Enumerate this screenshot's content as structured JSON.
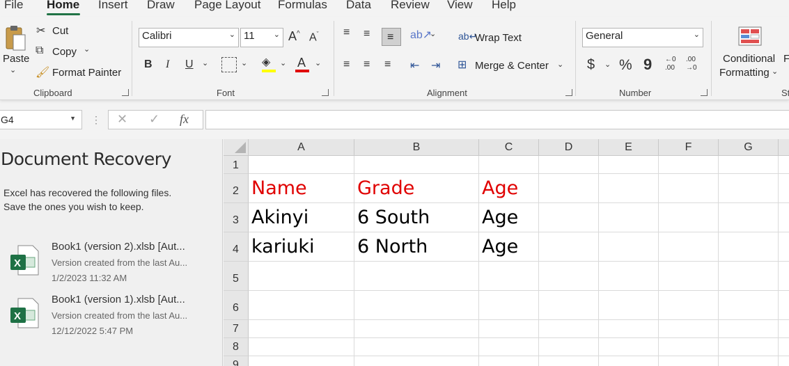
{
  "tabs": [
    "File",
    "Home",
    "Insert",
    "Draw",
    "Page Layout",
    "Formulas",
    "Data",
    "Review",
    "View",
    "Help"
  ],
  "ribbon": {
    "clipboard": {
      "paste": "Paste",
      "cut": "Cut",
      "copy": "Copy",
      "format_painter": "Format Painter",
      "label": "Clipboard"
    },
    "font": {
      "name": "Calibri",
      "size": "11",
      "label": "Font",
      "bold": "B",
      "italic": "I",
      "underline": "U",
      "grow": "A",
      "shrink": "A",
      "highlight_color": "#ffff00",
      "font_color": "#e00000"
    },
    "alignment": {
      "wrap_text": "Wrap Text",
      "merge_center": "Merge & Center",
      "label": "Alignment"
    },
    "number": {
      "format": "General",
      "currency": "$",
      "percent": "%",
      "comma": "9",
      "label": "Number",
      "inc_top": "←0",
      "inc_bottom": ".00",
      "dec_top": ".00",
      "dec_bottom": "→0"
    },
    "styles": {
      "conditional_line1": "Conditional",
      "conditional_line2": "Formatting",
      "cut_off_top": "F",
      "cut_off_bottom": "St"
    }
  },
  "formula_bar": {
    "name_box": "G4",
    "fx": "fx",
    "formula": ""
  },
  "recovery": {
    "title": "Document Recovery",
    "desc_line1": "Excel has recovered the following files.",
    "desc_line2": "Save the ones you wish to keep.",
    "files": [
      {
        "name": "Book1 (version 2).xlsb  [Aut...",
        "sub": "Version created from the last Au...",
        "date": "1/2/2023 11:32 AM"
      },
      {
        "name": "Book1 (version 1).xlsb  [Aut...",
        "sub": "Version created from the last Au...",
        "date": "12/12/2022 5:47 PM"
      }
    ]
  },
  "sheet": {
    "columns": [
      "A",
      "B",
      "C",
      "D",
      "E",
      "F",
      "G"
    ],
    "rows": [
      "1",
      "2",
      "3",
      "4",
      "5",
      "6",
      "7",
      "8",
      "9"
    ],
    "cells": {
      "A2": "Name",
      "B2": "Grade",
      "C2": "Age",
      "A3": "Akinyi",
      "B3": "6 South",
      "C3": "Age",
      "A4": "kariuki",
      "B4": "6 North",
      "C4": "Age"
    },
    "header_color": "#e00000"
  }
}
